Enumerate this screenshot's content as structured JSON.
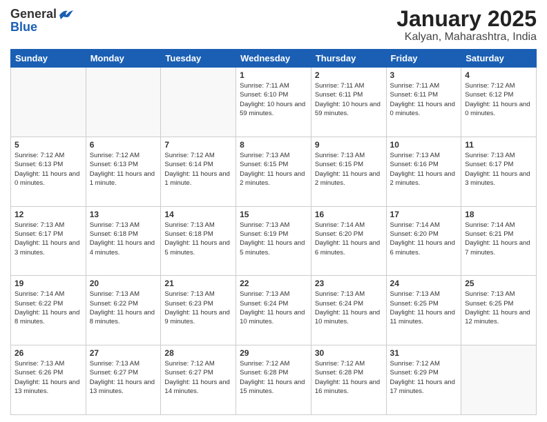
{
  "header": {
    "logo_general": "General",
    "logo_blue": "Blue",
    "month_title": "January 2025",
    "location": "Kalyan, Maharashtra, India"
  },
  "weekdays": [
    "Sunday",
    "Monday",
    "Tuesday",
    "Wednesday",
    "Thursday",
    "Friday",
    "Saturday"
  ],
  "weeks": [
    [
      {
        "day": "",
        "sunrise": "",
        "sunset": "",
        "daylight": ""
      },
      {
        "day": "",
        "sunrise": "",
        "sunset": "",
        "daylight": ""
      },
      {
        "day": "",
        "sunrise": "",
        "sunset": "",
        "daylight": ""
      },
      {
        "day": "1",
        "sunrise": "Sunrise: 7:11 AM",
        "sunset": "Sunset: 6:10 PM",
        "daylight": "Daylight: 10 hours and 59 minutes."
      },
      {
        "day": "2",
        "sunrise": "Sunrise: 7:11 AM",
        "sunset": "Sunset: 6:11 PM",
        "daylight": "Daylight: 10 hours and 59 minutes."
      },
      {
        "day": "3",
        "sunrise": "Sunrise: 7:11 AM",
        "sunset": "Sunset: 6:11 PM",
        "daylight": "Daylight: 11 hours and 0 minutes."
      },
      {
        "day": "4",
        "sunrise": "Sunrise: 7:12 AM",
        "sunset": "Sunset: 6:12 PM",
        "daylight": "Daylight: 11 hours and 0 minutes."
      }
    ],
    [
      {
        "day": "5",
        "sunrise": "Sunrise: 7:12 AM",
        "sunset": "Sunset: 6:13 PM",
        "daylight": "Daylight: 11 hours and 0 minutes."
      },
      {
        "day": "6",
        "sunrise": "Sunrise: 7:12 AM",
        "sunset": "Sunset: 6:13 PM",
        "daylight": "Daylight: 11 hours and 1 minute."
      },
      {
        "day": "7",
        "sunrise": "Sunrise: 7:12 AM",
        "sunset": "Sunset: 6:14 PM",
        "daylight": "Daylight: 11 hours and 1 minute."
      },
      {
        "day": "8",
        "sunrise": "Sunrise: 7:13 AM",
        "sunset": "Sunset: 6:15 PM",
        "daylight": "Daylight: 11 hours and 2 minutes."
      },
      {
        "day": "9",
        "sunrise": "Sunrise: 7:13 AM",
        "sunset": "Sunset: 6:15 PM",
        "daylight": "Daylight: 11 hours and 2 minutes."
      },
      {
        "day": "10",
        "sunrise": "Sunrise: 7:13 AM",
        "sunset": "Sunset: 6:16 PM",
        "daylight": "Daylight: 11 hours and 2 minutes."
      },
      {
        "day": "11",
        "sunrise": "Sunrise: 7:13 AM",
        "sunset": "Sunset: 6:17 PM",
        "daylight": "Daylight: 11 hours and 3 minutes."
      }
    ],
    [
      {
        "day": "12",
        "sunrise": "Sunrise: 7:13 AM",
        "sunset": "Sunset: 6:17 PM",
        "daylight": "Daylight: 11 hours and 3 minutes."
      },
      {
        "day": "13",
        "sunrise": "Sunrise: 7:13 AM",
        "sunset": "Sunset: 6:18 PM",
        "daylight": "Daylight: 11 hours and 4 minutes."
      },
      {
        "day": "14",
        "sunrise": "Sunrise: 7:13 AM",
        "sunset": "Sunset: 6:18 PM",
        "daylight": "Daylight: 11 hours and 5 minutes."
      },
      {
        "day": "15",
        "sunrise": "Sunrise: 7:13 AM",
        "sunset": "Sunset: 6:19 PM",
        "daylight": "Daylight: 11 hours and 5 minutes."
      },
      {
        "day": "16",
        "sunrise": "Sunrise: 7:14 AM",
        "sunset": "Sunset: 6:20 PM",
        "daylight": "Daylight: 11 hours and 6 minutes."
      },
      {
        "day": "17",
        "sunrise": "Sunrise: 7:14 AM",
        "sunset": "Sunset: 6:20 PM",
        "daylight": "Daylight: 11 hours and 6 minutes."
      },
      {
        "day": "18",
        "sunrise": "Sunrise: 7:14 AM",
        "sunset": "Sunset: 6:21 PM",
        "daylight": "Daylight: 11 hours and 7 minutes."
      }
    ],
    [
      {
        "day": "19",
        "sunrise": "Sunrise: 7:14 AM",
        "sunset": "Sunset: 6:22 PM",
        "daylight": "Daylight: 11 hours and 8 minutes."
      },
      {
        "day": "20",
        "sunrise": "Sunrise: 7:13 AM",
        "sunset": "Sunset: 6:22 PM",
        "daylight": "Daylight: 11 hours and 8 minutes."
      },
      {
        "day": "21",
        "sunrise": "Sunrise: 7:13 AM",
        "sunset": "Sunset: 6:23 PM",
        "daylight": "Daylight: 11 hours and 9 minutes."
      },
      {
        "day": "22",
        "sunrise": "Sunrise: 7:13 AM",
        "sunset": "Sunset: 6:24 PM",
        "daylight": "Daylight: 11 hours and 10 minutes."
      },
      {
        "day": "23",
        "sunrise": "Sunrise: 7:13 AM",
        "sunset": "Sunset: 6:24 PM",
        "daylight": "Daylight: 11 hours and 10 minutes."
      },
      {
        "day": "24",
        "sunrise": "Sunrise: 7:13 AM",
        "sunset": "Sunset: 6:25 PM",
        "daylight": "Daylight: 11 hours and 11 minutes."
      },
      {
        "day": "25",
        "sunrise": "Sunrise: 7:13 AM",
        "sunset": "Sunset: 6:25 PM",
        "daylight": "Daylight: 11 hours and 12 minutes."
      }
    ],
    [
      {
        "day": "26",
        "sunrise": "Sunrise: 7:13 AM",
        "sunset": "Sunset: 6:26 PM",
        "daylight": "Daylight: 11 hours and 13 minutes."
      },
      {
        "day": "27",
        "sunrise": "Sunrise: 7:13 AM",
        "sunset": "Sunset: 6:27 PM",
        "daylight": "Daylight: 11 hours and 13 minutes."
      },
      {
        "day": "28",
        "sunrise": "Sunrise: 7:12 AM",
        "sunset": "Sunset: 6:27 PM",
        "daylight": "Daylight: 11 hours and 14 minutes."
      },
      {
        "day": "29",
        "sunrise": "Sunrise: 7:12 AM",
        "sunset": "Sunset: 6:28 PM",
        "daylight": "Daylight: 11 hours and 15 minutes."
      },
      {
        "day": "30",
        "sunrise": "Sunrise: 7:12 AM",
        "sunset": "Sunset: 6:28 PM",
        "daylight": "Daylight: 11 hours and 16 minutes."
      },
      {
        "day": "31",
        "sunrise": "Sunrise: 7:12 AM",
        "sunset": "Sunset: 6:29 PM",
        "daylight": "Daylight: 11 hours and 17 minutes."
      },
      {
        "day": "",
        "sunrise": "",
        "sunset": "",
        "daylight": ""
      }
    ]
  ]
}
